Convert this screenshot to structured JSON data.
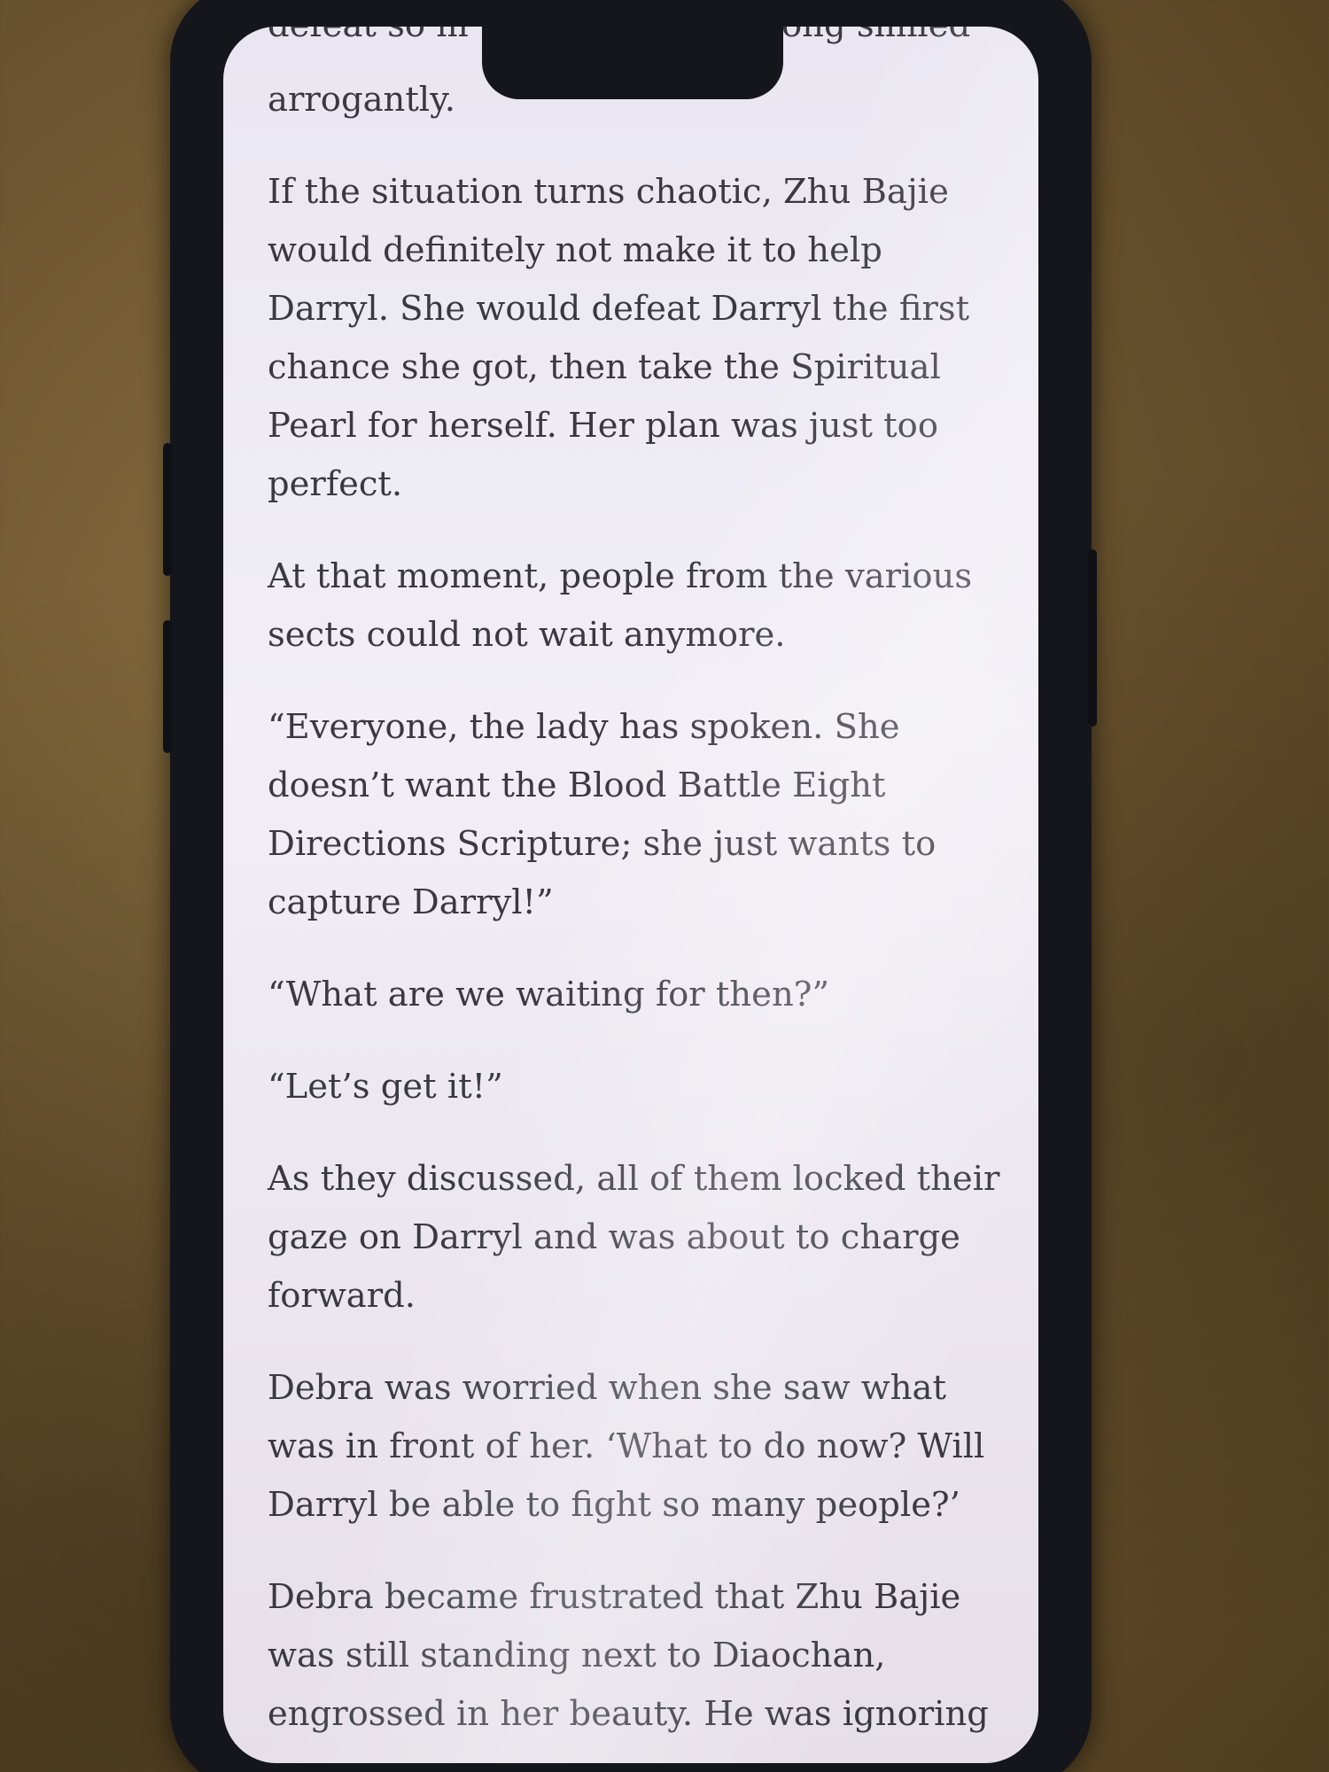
{
  "reader": {
    "cut_off_top": {
      "left_fragment": "defeat so m",
      "right_fragment": "ong smiled"
    },
    "paragraphs": [
      "arrogantly.",
      "If the situation turns chaotic, Zhu Bajie\nwould definitely not make it to help\nDarryl. She would defeat Darryl the first\nchance she got, then take the Spiritual\nPearl for herself. Her plan was just too\nperfect.",
      "At that moment, people from the various\nsects could not wait anymore.",
      "“Everyone, the lady has spoken. She\ndoesn’t want the Blood Battle Eight\nDirections Scripture; she just wants to\ncapture Darryl!”",
      "“What are we waiting for then?”",
      "“Let’s get it!”",
      "As they discussed, all of them locked their\ngaze on Darryl and was about to charge\nforward.",
      "Debra was worried when she saw what\nwas in front of her. ‘What to do now? Will\nDarryl be able to fight so many people?’",
      "Debra became frustrated that Zhu Bajie\nwas still standing next to Diaochan,\nengrossed in her beauty. He was ignoring"
    ]
  },
  "colors": {
    "screen_background": "#eeebf2",
    "text": "#3a3840",
    "phone_frame": "#14161c",
    "background_cloth": "#6e5630"
  }
}
